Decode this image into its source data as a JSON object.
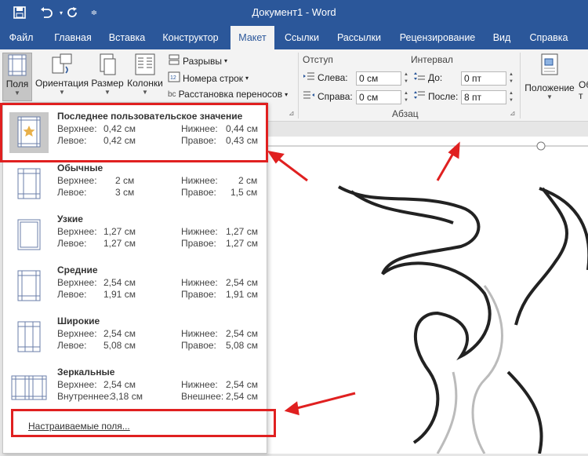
{
  "titlebar": {
    "title": "Документ1  -  Word",
    "icons": [
      "save-icon",
      "undo-icon",
      "redo-icon",
      "customize-qat-icon"
    ]
  },
  "tabs": [
    "Файл",
    "Главная",
    "Вставка",
    "Конструктор",
    "Макет",
    "Ссылки",
    "Рассылки",
    "Рецензирование",
    "Вид",
    "Справка"
  ],
  "active_tab": "Макет",
  "ribbon": {
    "margins": {
      "label": "Поля"
    },
    "orientation": {
      "label": "Ориентация"
    },
    "size": {
      "label": "Размер"
    },
    "columns": {
      "label": "Колонки"
    },
    "breaks": "Разрывы",
    "line_numbers": "Номера строк",
    "hyphenation": "Расстановка переносов",
    "indent": {
      "header": "Отступ",
      "left_label": "Слева:",
      "left_value": "0 см",
      "right_label": "Справа:",
      "right_value": "0 см"
    },
    "spacing": {
      "header": "Интервал",
      "before_label": "До:",
      "before_value": "0 пт",
      "after_label": "После:",
      "after_value": "8 пт"
    },
    "paragraph_group": "Абзац",
    "position": {
      "label": "Положение"
    },
    "wrap_fragment": "Об т"
  },
  "margins_menu": {
    "options": [
      {
        "name": "Последнее пользовательское значение",
        "row1": {
          "l1": "Верхнее:",
          "v1": "0,42 см",
          "l2": "Нижнее:",
          "v2": "0,44 см"
        },
        "row2": {
          "l1": "Левое:",
          "v1": "0,42 см",
          "l2": "Правое:",
          "v2": "0,43 см"
        }
      },
      {
        "name": "Обычные",
        "row1": {
          "l1": "Верхнее:",
          "v1": "2 см",
          "l2": "Нижнее:",
          "v2": "2 см"
        },
        "row2": {
          "l1": "Левое:",
          "v1": "3 см",
          "l2": "Правое:",
          "v2": "1,5 см"
        }
      },
      {
        "name": "Узкие",
        "row1": {
          "l1": "Верхнее:",
          "v1": "1,27 см",
          "l2": "Нижнее:",
          "v2": "1,27 см"
        },
        "row2": {
          "l1": "Левое:",
          "v1": "1,27 см",
          "l2": "Правое:",
          "v2": "1,27 см"
        }
      },
      {
        "name": "Средние",
        "row1": {
          "l1": "Верхнее:",
          "v1": "2,54 см",
          "l2": "Нижнее:",
          "v2": "2,54 см"
        },
        "row2": {
          "l1": "Левое:",
          "v1": "1,91 см",
          "l2": "Правое:",
          "v2": "1,91 см"
        }
      },
      {
        "name": "Широкие",
        "row1": {
          "l1": "Верхнее:",
          "v1": "2,54 см",
          "l2": "Нижнее:",
          "v2": "2,54 см"
        },
        "row2": {
          "l1": "Левое:",
          "v1": "5,08 см",
          "l2": "Правое:",
          "v2": "5,08 см"
        }
      },
      {
        "name": "Зеркальные",
        "row1": {
          "l1": "Верхнее:",
          "v1": "2,54 см",
          "l2": "Нижнее:",
          "v2": "2,54 см"
        },
        "row2": {
          "l1": "Внутреннее:",
          "v1": "3,18 см",
          "l2": "Внешнее:",
          "v2": "2,54 см"
        }
      }
    ],
    "custom_label": "Настраиваемые поля...",
    "annotation_color": "#e02020"
  }
}
